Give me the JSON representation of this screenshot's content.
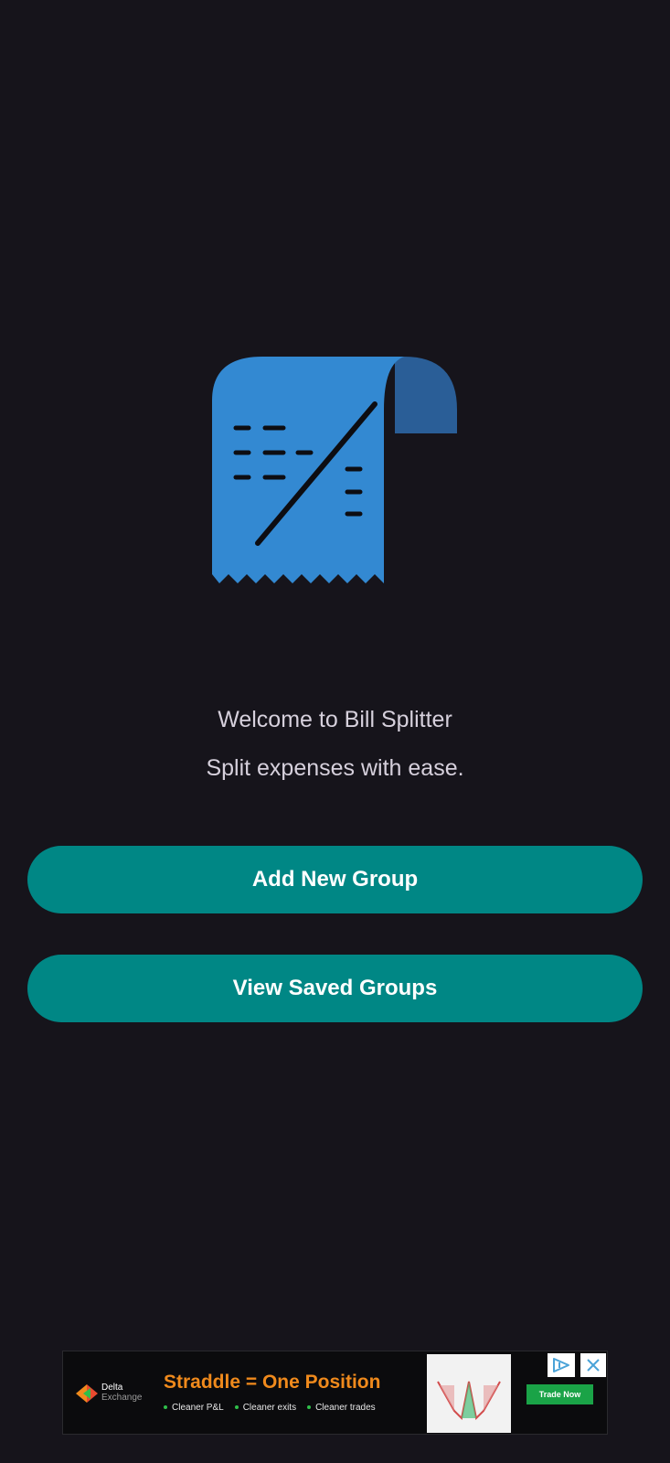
{
  "app": {
    "welcome_title": "Welcome to Bill Splitter",
    "welcome_subtitle": "Split expenses with ease."
  },
  "actions": {
    "add_group_label": "Add New Group",
    "view_groups_label": "View Saved Groups"
  },
  "colors": {
    "background": "#16141b",
    "button": "#008785",
    "receipt_blue": "#3389d2",
    "receipt_fold": "#2a5e97",
    "ad_headline": "#f08a1c",
    "ad_cta": "#1aa347"
  },
  "icons": {
    "logo": "receipt-split-icon",
    "ad_choices": "ad-choices-icon",
    "ad_close": "close-icon"
  },
  "ad": {
    "brand_name": "Delta",
    "brand_sub": "Exchange",
    "headline": "Straddle = One Position",
    "bullets": [
      "Cleaner P&L",
      "Cleaner exits",
      "Cleaner trades"
    ],
    "cta": "Trade Now"
  }
}
